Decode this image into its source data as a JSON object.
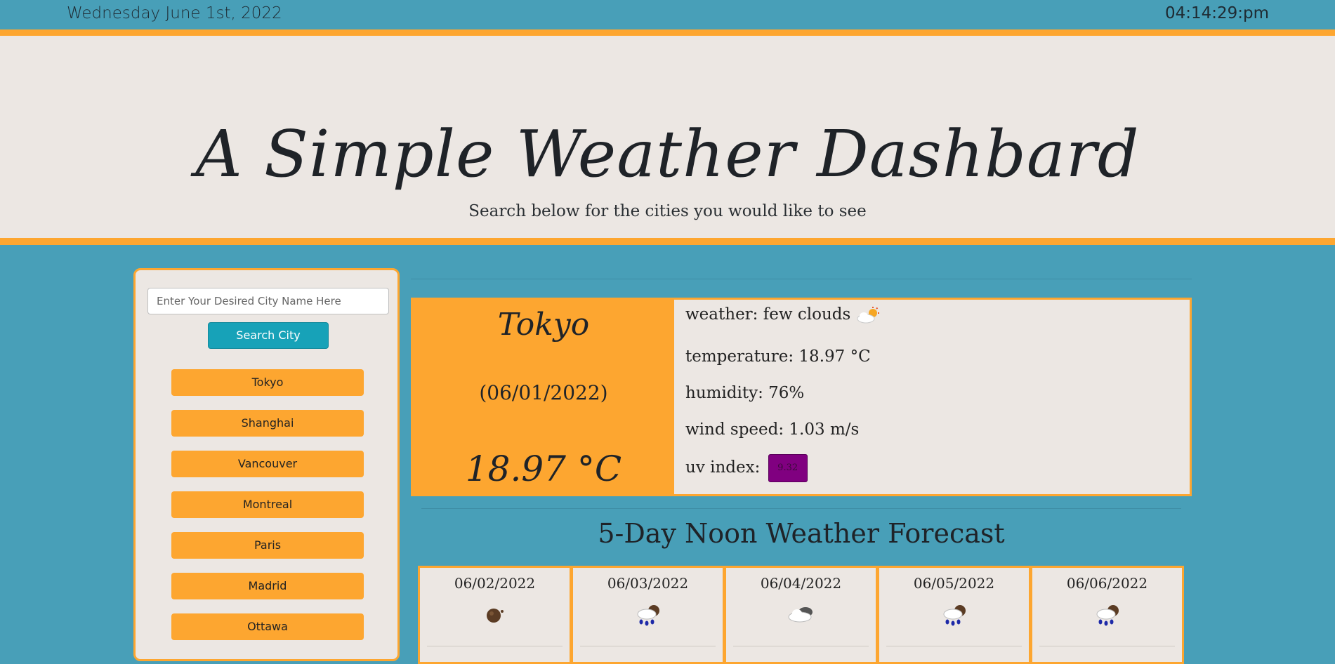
{
  "topbar": {
    "date": "Wednesday June 1st, 2022",
    "time": "04:14:29:pm"
  },
  "hero": {
    "title": "A Simple Weather Dashbard",
    "subtitle": "Search below for the cities you would like to see"
  },
  "search": {
    "placeholder": "Enter Your Desired City Name Here",
    "button_label": "Search City"
  },
  "cities": [
    "Tokyo",
    "Shanghai",
    "Vancouver",
    "Montreal",
    "Paris",
    "Madrid",
    "Ottawa"
  ],
  "current": {
    "city": "Tokyo",
    "date": "(06/01/2022)",
    "temp": "18.97 °C",
    "weather": "weather: few clouds",
    "weather_icon": "few-clouds-icon",
    "temperature": "temperature: 18.97 °C",
    "humidity": "humidity: 76%",
    "wind": "wind speed: 1.03 m/s",
    "uv_label": "uv index:",
    "uv_value": "9.32",
    "uv_color": "#800080"
  },
  "forecast_title": "5-Day Noon Weather Forecast",
  "forecast": [
    {
      "date": "06/02/2022",
      "icon": "moon-dark-icon"
    },
    {
      "date": "06/03/2022",
      "icon": "rain-icon"
    },
    {
      "date": "06/04/2022",
      "icon": "cloud-icon"
    },
    {
      "date": "06/05/2022",
      "icon": "rain-icon"
    },
    {
      "date": "06/06/2022",
      "icon": "rain-icon"
    }
  ],
  "colors": {
    "background": "#489fb8",
    "accent": "#fda630",
    "panel": "#ece7e3",
    "button": "#17a2b8"
  }
}
